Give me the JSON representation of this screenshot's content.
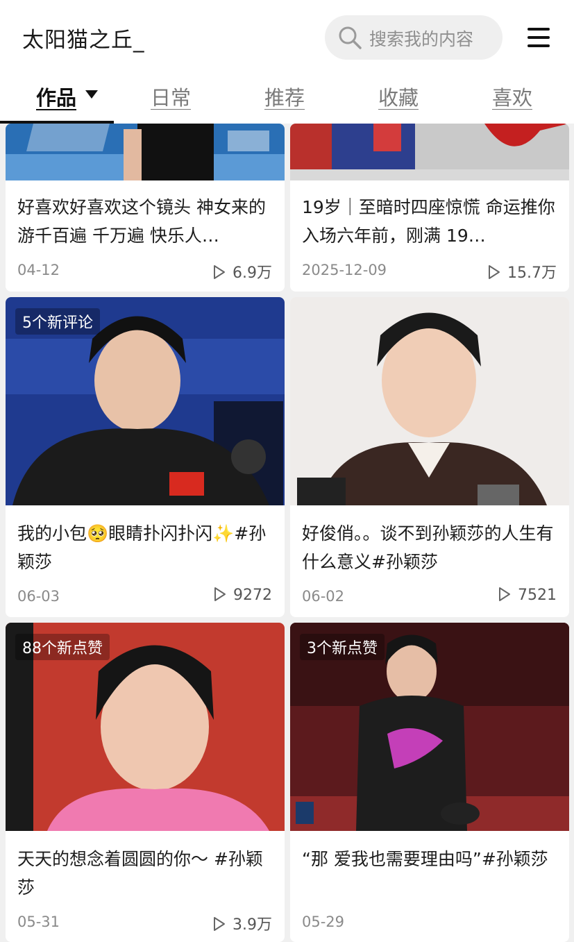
{
  "header": {
    "title": "太阳猫之丘_",
    "search_placeholder": "搜索我的内容"
  },
  "tabs": [
    {
      "label": "作品",
      "active": true
    },
    {
      "label": "日常"
    },
    {
      "label": "推荐"
    },
    {
      "label": "收藏"
    },
    {
      "label": "喜欢"
    }
  ],
  "cards": [
    {
      "title": "好喜欢好喜欢这个镜头 神女来的游千百遍 千万遍 快乐人…",
      "date": "04-12",
      "plays": "6.9万"
    },
    {
      "title": "19岁｜至暗时四座惊慌 命运推你入场六年前，刚满 19…",
      "date": "2025-12-09",
      "plays": "15.7万"
    },
    {
      "badge": "5个新评论",
      "title": "我的小包🥺眼睛扑闪扑闪✨#孙颖莎",
      "date": "06-03",
      "plays": "9272"
    },
    {
      "title": "好俊俏。。谈不到孙颖莎的人生有什么意义#孙颖莎",
      "date": "06-02",
      "plays": "7521"
    },
    {
      "badge": "88个新点赞",
      "title": "天天的想念着圆圆的你～ #孙颖莎",
      "date": "05-31",
      "plays": "3.9万"
    },
    {
      "badge": "3个新点赞",
      "title": "“那 爱我也需要理由吗”#孙颖莎",
      "date": "05-29",
      "plays": ""
    }
  ],
  "colors": {
    "accent": "#111111",
    "muted": "#8a8a8a",
    "search_bg": "#efefef"
  },
  "icons": [
    "search-icon",
    "menu-icon",
    "play-icon",
    "caret-down-icon"
  ]
}
